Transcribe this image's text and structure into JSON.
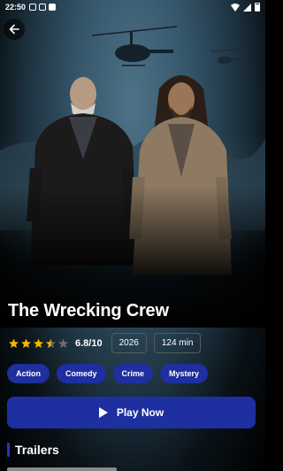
{
  "status_bar": {
    "time": "22:50"
  },
  "movie": {
    "title": "The Wrecking Crew",
    "rating_text": "6.8/10",
    "rating_stars": 3.5,
    "rating_max_stars": 5,
    "year": "2026",
    "runtime": "124 min",
    "genres": [
      "Action",
      "Comedy",
      "Crime",
      "Mystery"
    ]
  },
  "actions": {
    "play_label": "Play Now"
  },
  "sections": {
    "trailers_label": "Trailers"
  },
  "colors": {
    "accent": "#1e2fa0",
    "star": "#f5b800"
  }
}
